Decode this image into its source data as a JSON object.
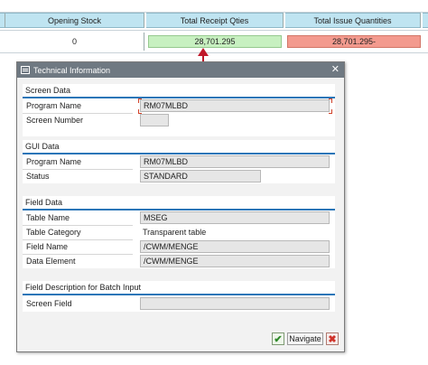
{
  "table": {
    "headers": [
      "Opening Stock",
      "Total Receipt Qties",
      "Total Issue Quantities"
    ],
    "values": [
      "0",
      "28,701.295",
      "28,701.295-"
    ]
  },
  "dialog": {
    "title": "Technical Information",
    "close_icon": "close-icon",
    "groups": {
      "screen_data": {
        "title": "Screen Data",
        "rows": [
          {
            "label": "Program Name",
            "value": "RM07MLBD"
          },
          {
            "label": "Screen Number",
            "value": ""
          }
        ]
      },
      "gui_data": {
        "title": "GUI Data",
        "rows": [
          {
            "label": "Program Name",
            "value": "RM07MLBD"
          },
          {
            "label": "Status",
            "value": "STANDARD"
          }
        ]
      },
      "field_data": {
        "title": "Field Data",
        "rows": [
          {
            "label": "Table Name",
            "value": "MSEG"
          },
          {
            "label": "Table Category",
            "value": "Transparent table"
          },
          {
            "label": "Field Name",
            "value": "/CWM/MENGE"
          },
          {
            "label": "Data Element",
            "value": "/CWM/MENGE"
          }
        ]
      },
      "batch_input": {
        "title": "Field Description for Batch Input",
        "rows": [
          {
            "label": "Screen Field",
            "value": ""
          }
        ]
      }
    },
    "buttons": {
      "ok": "✔",
      "navigate": "Navigate",
      "cancel": "✖"
    }
  },
  "colors": {
    "header_bg": "#bfe4f1",
    "receipt_bg": "#c7f0c0",
    "issue_bg": "#f39a8e",
    "titlebar_bg": "#6f7982",
    "group_line": "#2b76b8",
    "arrow": "#c0182a"
  }
}
